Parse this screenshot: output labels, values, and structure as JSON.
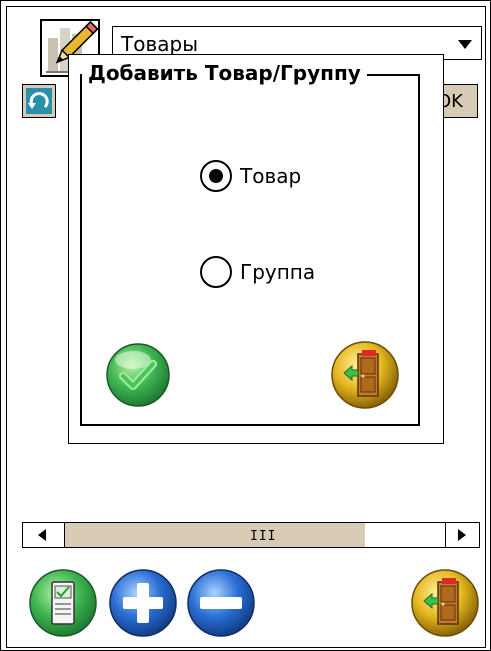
{
  "header": {
    "category_value": "Товары"
  },
  "toolbar": {
    "ok_label": "OK"
  },
  "dialog": {
    "title": "Добавить Товар/Группу",
    "options": [
      {
        "label": "Товар",
        "selected": true
      },
      {
        "label": "Группа",
        "selected": false
      }
    ]
  },
  "scrollbar": {
    "grip": "III"
  },
  "icons": {
    "edit": "edit-pencil-icon",
    "refresh": "refresh-icon",
    "confirm": "checkmark-icon",
    "exit": "exit-door-icon",
    "document": "document-icon",
    "add": "plus-icon",
    "remove": "minus-icon"
  },
  "colors": {
    "green": "#2ea84a",
    "blue": "#1c5fc9",
    "gold": "#e0b21a",
    "beige": "#d8cbb6"
  }
}
